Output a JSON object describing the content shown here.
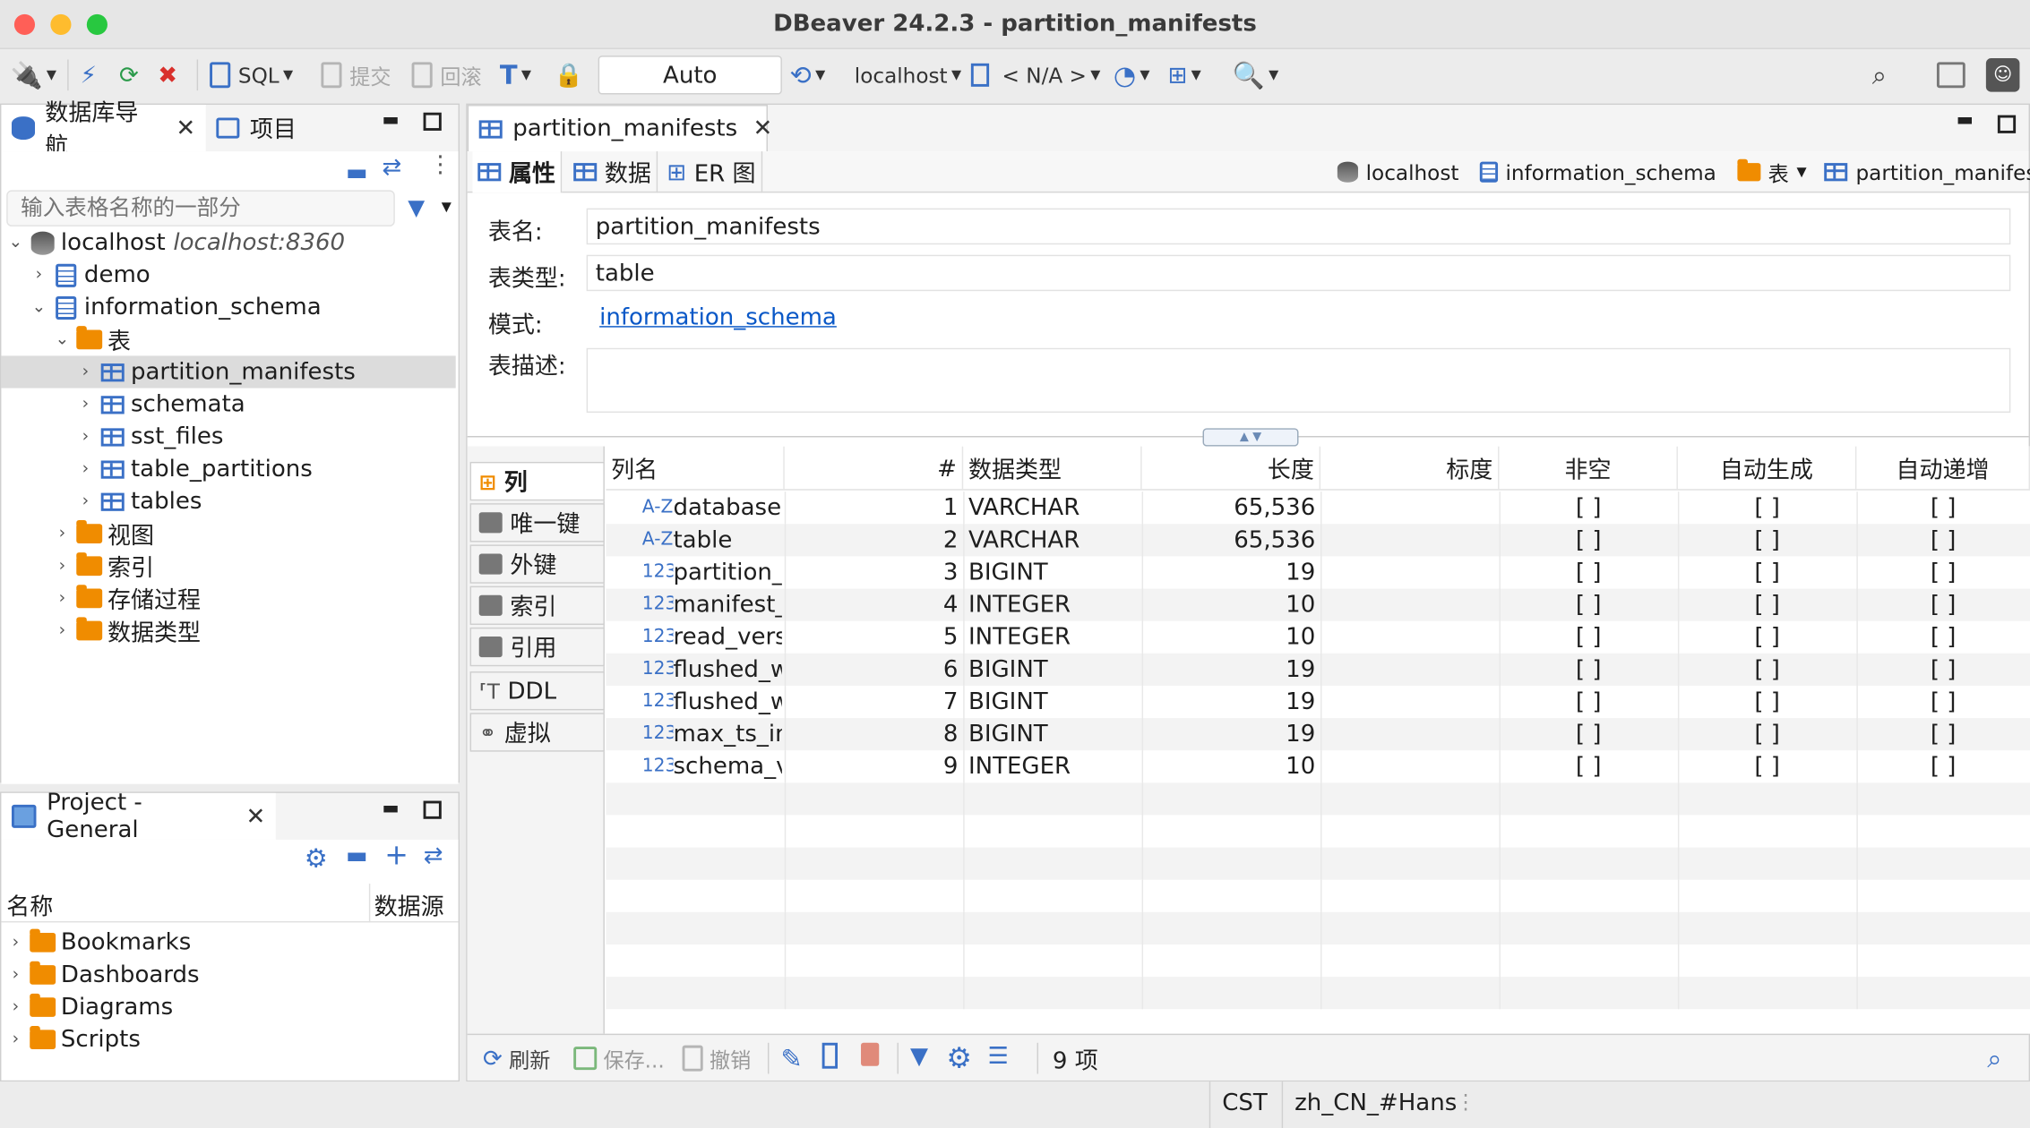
{
  "window": {
    "title": "DBeaver 24.2.3 - partition_manifests",
    "colors": {
      "close": "#ff5f57",
      "minimize": "#febc2e",
      "zoom": "#28c840",
      "accent": "#3a70c6",
      "folder": "#f08c00"
    }
  },
  "toolbar": {
    "sql_label": "SQL",
    "commit_label": "提交",
    "rollback_label": "回滚",
    "tx_mode": "Auto",
    "connection": "localhost",
    "schema": "< N/A >"
  },
  "navigator": {
    "tab_label": "数据库导航",
    "projects_tab_label": "项目",
    "filter_placeholder": "输入表格名称的一部分",
    "connection": {
      "name": "localhost",
      "host": "localhost:8360"
    },
    "items": [
      {
        "label": "demo",
        "icon": "schema-icon"
      },
      {
        "label": "information_schema",
        "icon": "schema-icon"
      },
      {
        "label": "表",
        "icon": "tables-folder-icon"
      },
      {
        "label": "partition_manifests",
        "icon": "table-icon"
      },
      {
        "label": "schemata",
        "icon": "table-icon"
      },
      {
        "label": "sst_files",
        "icon": "table-icon"
      },
      {
        "label": "table_partitions",
        "icon": "table-icon"
      },
      {
        "label": "tables",
        "icon": "table-icon"
      },
      {
        "label": "视图",
        "icon": "views-folder-icon"
      },
      {
        "label": "索引",
        "icon": "folder-icon"
      },
      {
        "label": "存储过程",
        "icon": "folder-icon"
      },
      {
        "label": "数据类型",
        "icon": "folder-icon"
      }
    ]
  },
  "project": {
    "tab_label": "Project - General",
    "col_name": "名称",
    "col_datasource": "数据源",
    "items": [
      {
        "label": "Bookmarks",
        "icon": "bookmarks-folder-icon"
      },
      {
        "label": "Dashboards",
        "icon": "dashboards-folder-icon"
      },
      {
        "label": "Diagrams",
        "icon": "diagrams-folder-icon"
      },
      {
        "label": "Scripts",
        "icon": "scripts-folder-icon"
      }
    ]
  },
  "editor": {
    "tab_label": "partition_manifests",
    "subtabs": {
      "properties": "属性",
      "data": "数据",
      "er": "ER 图"
    },
    "breadcrumb": {
      "connection": "localhost",
      "schema": "information_schema",
      "folder": "表",
      "table": "partition_manifests"
    },
    "props": {
      "table_name_label": "表名:",
      "table_name": "partition_manifests",
      "table_type_label": "表类型:",
      "table_type": "table",
      "schema_label": "模式:",
      "schema": "information_schema",
      "desc_label": "表描述:"
    },
    "side_tabs": [
      "列",
      "唯一键",
      "外键",
      "索引",
      "引用",
      "DDL",
      "虚拟"
    ],
    "columns": {
      "headers": {
        "name": "列名",
        "num": "#",
        "type": "数据类型",
        "length": "长度",
        "scale": "标度",
        "notnull": "非空",
        "autogen": "自动生成",
        "autoinc": "自动递增"
      },
      "rows": [
        {
          "kind": "A-Z",
          "name": "database",
          "num": "1",
          "type": "VARCHAR",
          "length": "65,536",
          "notnull": "[ ]",
          "autogen": "[ ]",
          "autoinc": "[ ]"
        },
        {
          "kind": "A-Z",
          "name": "table",
          "num": "2",
          "type": "VARCHAR",
          "length": "65,536",
          "notnull": "[ ]",
          "autogen": "[ ]",
          "autoinc": "[ ]"
        },
        {
          "kind": "123",
          "name": "partition_",
          "num": "3",
          "type": "BIGINT",
          "length": "19",
          "notnull": "[ ]",
          "autogen": "[ ]",
          "autoinc": "[ ]"
        },
        {
          "kind": "123",
          "name": "manifest_",
          "num": "4",
          "type": "INTEGER",
          "length": "10",
          "notnull": "[ ]",
          "autogen": "[ ]",
          "autoinc": "[ ]"
        },
        {
          "kind": "123",
          "name": "read_vers",
          "num": "5",
          "type": "INTEGER",
          "length": "10",
          "notnull": "[ ]",
          "autogen": "[ ]",
          "autoinc": "[ ]"
        },
        {
          "kind": "123",
          "name": "flushed_w",
          "num": "6",
          "type": "BIGINT",
          "length": "19",
          "notnull": "[ ]",
          "autogen": "[ ]",
          "autoinc": "[ ]"
        },
        {
          "kind": "123",
          "name": "flushed_w",
          "num": "7",
          "type": "BIGINT",
          "length": "19",
          "notnull": "[ ]",
          "autogen": "[ ]",
          "autoinc": "[ ]"
        },
        {
          "kind": "123",
          "name": "max_ts_in",
          "num": "8",
          "type": "BIGINT",
          "length": "19",
          "notnull": "[ ]",
          "autogen": "[ ]",
          "autoinc": "[ ]"
        },
        {
          "kind": "123",
          "name": "schema_v",
          "num": "9",
          "type": "INTEGER",
          "length": "10",
          "notnull": "[ ]",
          "autogen": "[ ]",
          "autoinc": "[ ]"
        }
      ]
    },
    "bottom": {
      "refresh": "刷新",
      "save": "保存...",
      "cancel": "撤销",
      "count": "9 项"
    }
  },
  "status": {
    "timezone": "CST",
    "locale": "zh_CN_#Hans"
  }
}
